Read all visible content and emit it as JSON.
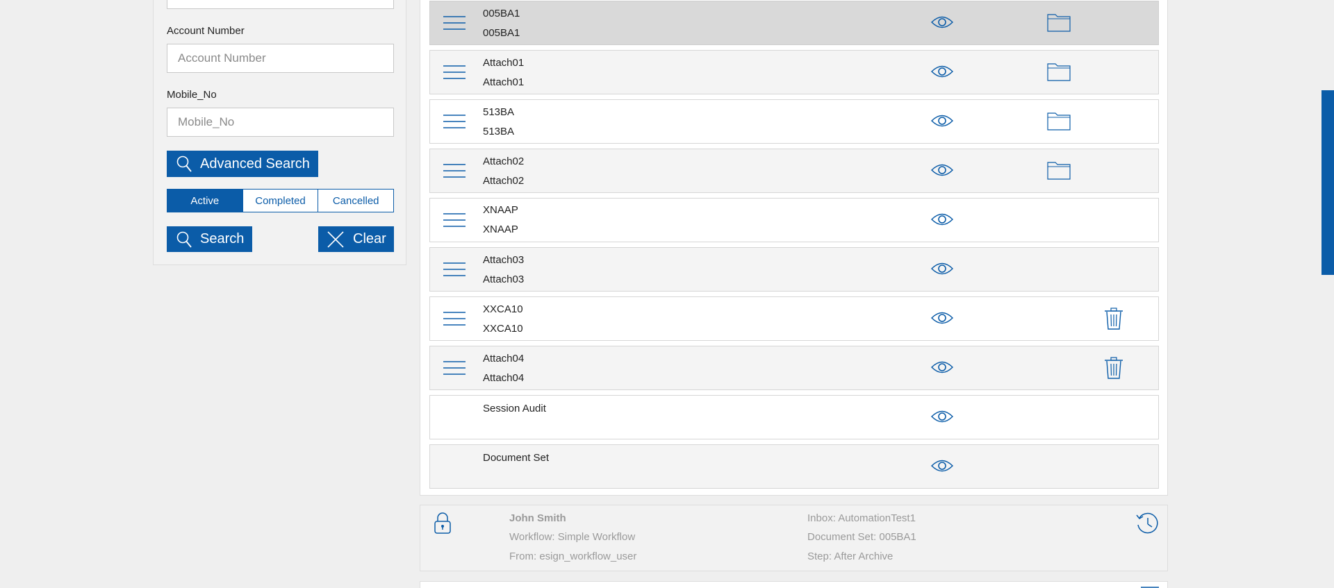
{
  "search_panel": {
    "account_number_label": "Account Number",
    "account_number_placeholder": "Account Number",
    "mobile_label": "Mobile_No",
    "mobile_placeholder": "Mobile_No",
    "advanced_search_label": "Advanced Search",
    "status_tabs": [
      "Active",
      "Completed",
      "Cancelled"
    ],
    "selected_status": "Active",
    "search_label": "Search",
    "clear_label": "Clear"
  },
  "documents": [
    {
      "line1": "005BA1",
      "line2": "005BA1",
      "action": "folder",
      "selected": true
    },
    {
      "line1": "Attach01",
      "line2": "Attach01",
      "action": "folder"
    },
    {
      "line1": "513BA",
      "line2": "513BA",
      "action": "folder"
    },
    {
      "line1": "Attach02",
      "line2": "Attach02",
      "action": "folder"
    },
    {
      "line1": "XNAAP",
      "line2": "XNAAP",
      "action": "none"
    },
    {
      "line1": "Attach03",
      "line2": "Attach03",
      "action": "none"
    },
    {
      "line1": "XXCA10",
      "line2": "XXCA10",
      "action": "delete"
    },
    {
      "line1": "Attach04",
      "line2": "Attach04",
      "action": "delete"
    },
    {
      "line1": "Session Audit",
      "line2": "",
      "action": "none",
      "no_menu": true
    },
    {
      "line1": "Document Set",
      "line2": "",
      "action": "none",
      "no_menu": true
    }
  ],
  "info": {
    "user": "John Smith",
    "workflow": "Workflow: Simple Workflow",
    "from": "From: esign_workflow_user",
    "inbox": "Inbox: AutomationTest1",
    "document_set": "Document Set: 005BA1",
    "step": "Step: After Archive"
  },
  "colors": {
    "accent": "#0b5ca8",
    "selected_row": "#d9d9d9",
    "alt_row": "#f4f4f4"
  },
  "icons": {
    "row_menu": "hamburger-icon",
    "row_view": "eye-icon",
    "row_folder": "folder-icon",
    "row_delete": "trash-icon",
    "lock": "lock-icon",
    "history": "clock-icon"
  }
}
